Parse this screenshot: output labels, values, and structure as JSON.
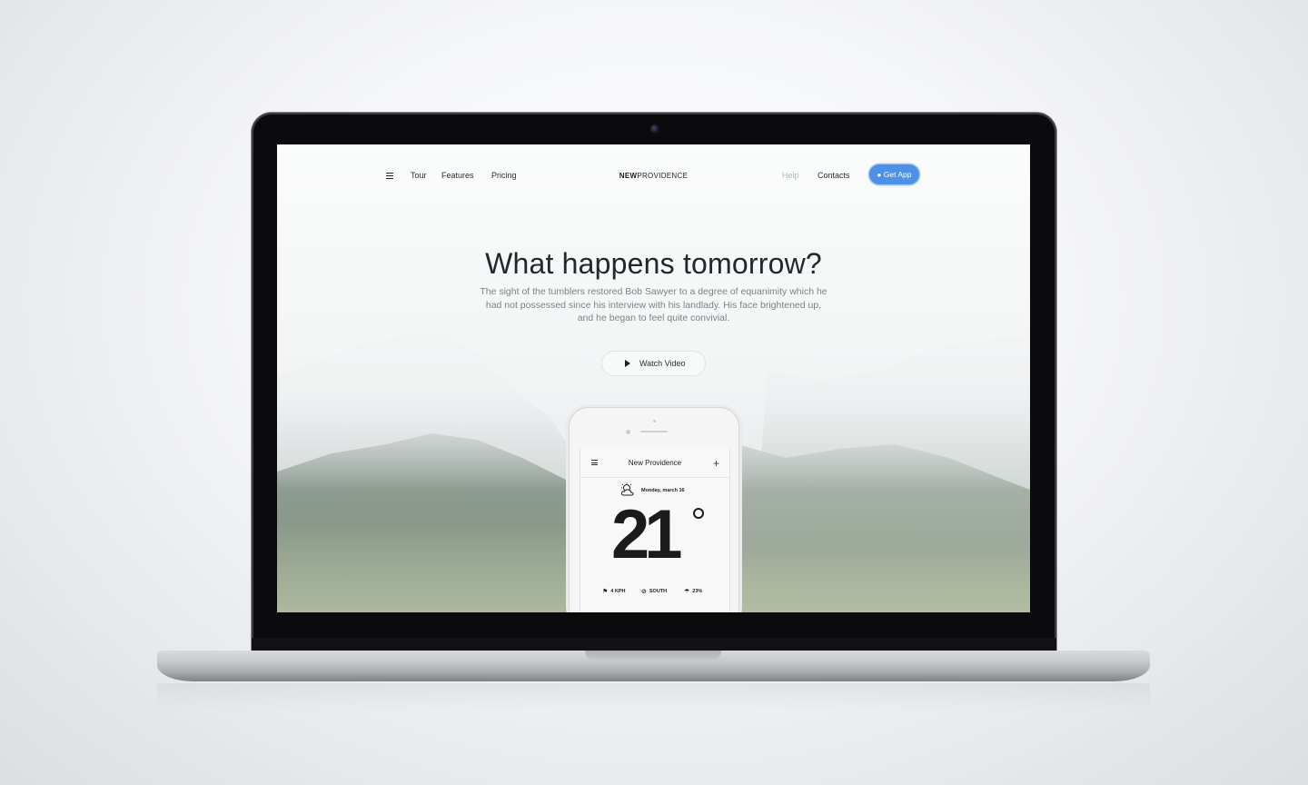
{
  "nav": {
    "menu_icon": "hamburger-icon",
    "links": [
      "Tour",
      "Features",
      "Pricing"
    ],
    "logo_bold": "NEW",
    "logo_light": "PROVIDENCE",
    "help": "Help",
    "contacts": "Contacts",
    "get_app": "Get App",
    "get_app_icon": "apple-icon",
    "get_app_color": "#4c91e6"
  },
  "hero": {
    "title": "What happens tomorrow?",
    "text": "The sight of the tumblers restored Bob Sawyer to a degree of equanimity which he had not possessed since his interview with his landlady. His face brightened up, and he began to feel quite convivial.",
    "watch_label": "Watch Video",
    "watch_icon": "play-icon"
  },
  "phone_app": {
    "city": "New Providence",
    "menu_icon": "hamburger-icon",
    "add_icon": "plus-icon",
    "weather_icon": "partly-cloudy-icon",
    "date": "Monday, march 16",
    "temperature": "21",
    "stats": [
      {
        "icon": "flag-icon",
        "value": "4 KPH"
      },
      {
        "icon": "compass-icon",
        "value": "SOUTH"
      },
      {
        "icon": "umbrella-icon",
        "value": "23%"
      }
    ]
  }
}
